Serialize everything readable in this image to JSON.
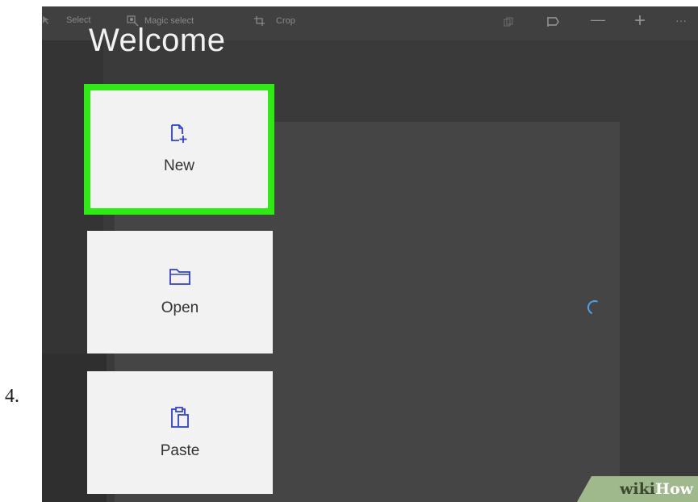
{
  "step_number": "4.",
  "toolbar": {
    "select_label": "Select",
    "magic_select_label": "Magic select",
    "crop_label": "Crop",
    "right_icons": [
      "copy-icon",
      "flag-icon",
      "minus-icon",
      "plus-icon",
      "more-icon"
    ],
    "minus_glyph": "—",
    "plus_glyph": "+",
    "more_glyph": "···"
  },
  "welcome": {
    "title": "Welcome",
    "tiles": [
      {
        "label": "New",
        "icon": "new-document-icon",
        "highlighted": true
      },
      {
        "label": "Open",
        "icon": "folder-icon"
      },
      {
        "label": "Paste",
        "icon": "clipboard-icon"
      }
    ]
  },
  "colors": {
    "highlight": "#2cec12",
    "icon_accent": "#2f3fd8",
    "background": "#3a3a3a"
  },
  "watermark": {
    "wiki": "wiki",
    "how": "How"
  }
}
